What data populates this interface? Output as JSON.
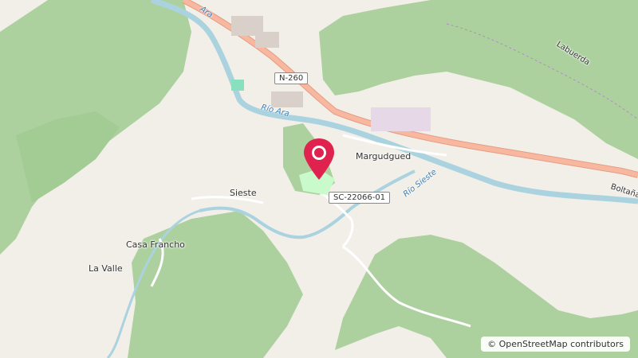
{
  "map": {
    "places": {
      "margudgued": "Margudgued",
      "sieste": "Sieste",
      "casa_francho": "Casa Francho",
      "la_valle": "La Valle",
      "laduerda": "Labuerda",
      "boltana": "Boltaña"
    },
    "rivers": {
      "ara": "Río Ara",
      "sieste": "Río Sieste",
      "ara_partial": "Ara"
    },
    "roads": {
      "n260": "N-260",
      "sc22066": "SC-22066-01"
    },
    "marker_icon": "map-pin-icon",
    "colors": {
      "forest": "#add19e",
      "background": "#f2efe9",
      "water": "#aad3df",
      "trunk_road": "#f8b8a0",
      "marker": "#e0234e"
    }
  },
  "attribution": {
    "symbol": "©",
    "text": "OpenStreetMap contributors"
  }
}
